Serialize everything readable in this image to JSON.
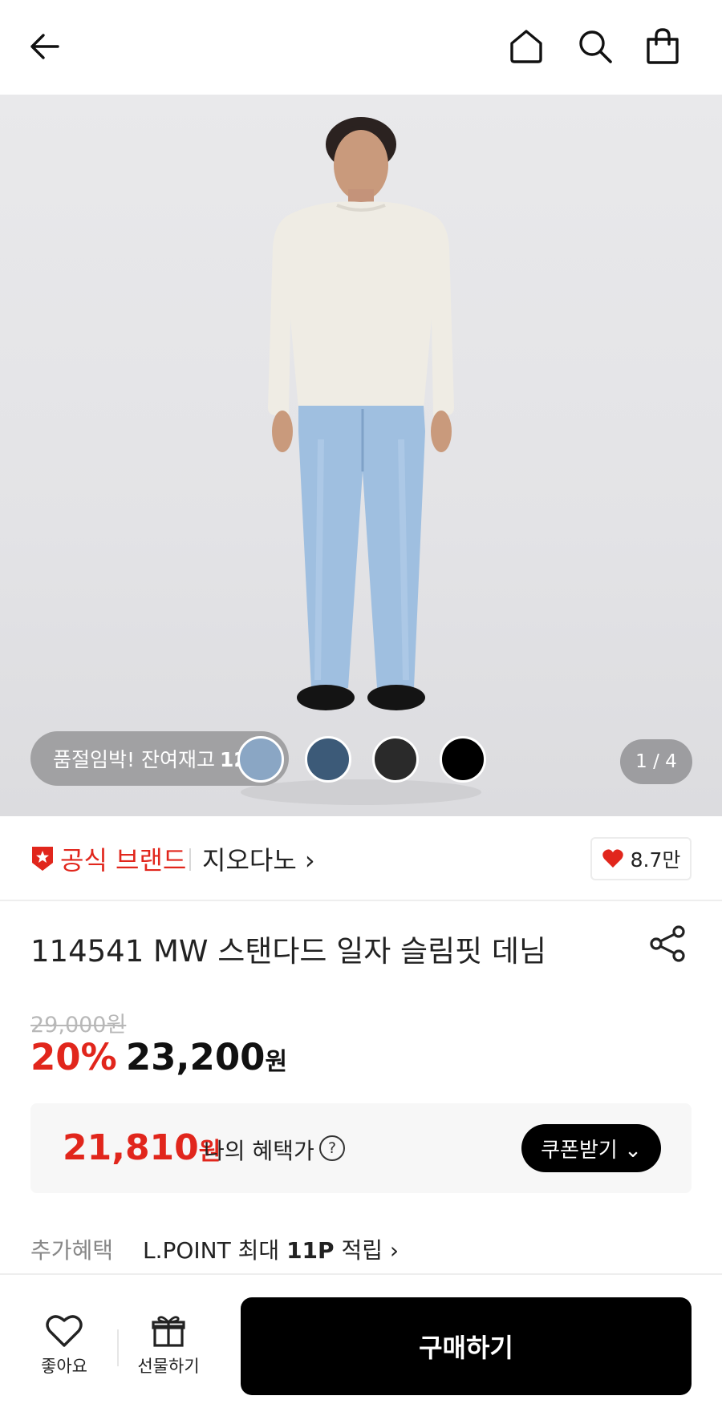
{
  "header": {
    "back_icon": "arrow-left-icon",
    "home_icon": "home-icon",
    "search_icon": "search-icon",
    "cart_icon": "shopping-bag-icon"
  },
  "gallery": {
    "stock_notice": "품절임박! 잔여재고",
    "stock_count": "12개!",
    "counter": "1 / 4",
    "swatches": [
      "#8aa6c4",
      "#3c5a78",
      "#2a2a2a",
      "#000000"
    ]
  },
  "brand": {
    "official_label": "공식 브랜드",
    "name": "지오다노 ›",
    "likes": "8.7만"
  },
  "product": {
    "title": "114541 MW 스탠다드 일자 슬림핏 데님",
    "original_price": "29,000원",
    "discount": "20%",
    "sale_price": "23,200",
    "currency": "원"
  },
  "benefit": {
    "price": "21,810",
    "currency": "원",
    "label": "나의 혜택가",
    "help": "?",
    "coupon_button": "쿠폰받기 ⌄"
  },
  "extra": {
    "label": "추가혜택",
    "prefix": "L.POINT 최대",
    "points": "11P",
    "suffix": "적립 ›"
  },
  "bottom": {
    "like_label": "좋아요",
    "gift_label": "선물하기",
    "buy_label": "구매하기"
  },
  "colors": {
    "accent_red": "#e1261c",
    "black": "#000000"
  }
}
